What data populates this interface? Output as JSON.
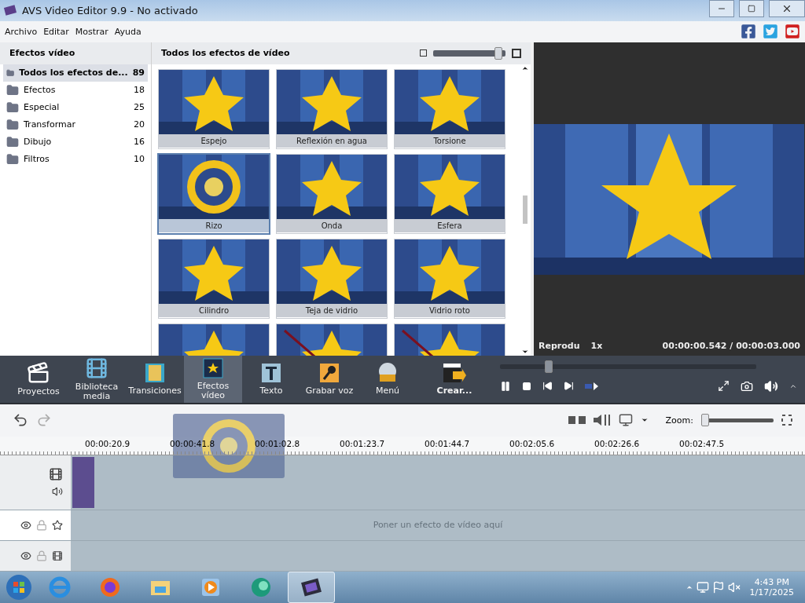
{
  "window": {
    "title": "AVS Video Editor 9.9 - No activado"
  },
  "menu": [
    "Archivo",
    "Editar",
    "Mostrar",
    "Ayuda"
  ],
  "categories": {
    "title": "Efectos vídeo",
    "items": [
      {
        "label": "Todos los efectos de...",
        "count": "89",
        "selected": true
      },
      {
        "label": "Efectos",
        "count": "18",
        "selected": false
      },
      {
        "label": "Especial",
        "count": "25",
        "selected": false
      },
      {
        "label": "Transformar",
        "count": "20",
        "selected": false
      },
      {
        "label": "Dibujo",
        "count": "16",
        "selected": false
      },
      {
        "label": "Filtros",
        "count": "10",
        "selected": false
      }
    ]
  },
  "effects": {
    "title": "Todos los efectos de vídeo",
    "size_slider": {
      "level": 0.95
    },
    "items": [
      {
        "label": "Espejo",
        "selected": false
      },
      {
        "label": "Reflexión en agua",
        "selected": false
      },
      {
        "label": "Torsione",
        "selected": false
      },
      {
        "label": "Rizo",
        "selected": true
      },
      {
        "label": "Onda",
        "selected": false
      },
      {
        "label": "Esfera",
        "selected": false
      },
      {
        "label": "Cilindro",
        "selected": false
      },
      {
        "label": "Teja de vidrio",
        "selected": false
      },
      {
        "label": "Vidrio roto",
        "selected": false
      },
      {
        "selected": false
      },
      {
        "selected": false
      },
      {
        "selected": false
      }
    ]
  },
  "preview": {
    "mode": "Reprodu",
    "speed": "1x",
    "time": "00:00:00.542 / 00:00:03.000",
    "seek": {
      "level": 0.18
    }
  },
  "toolbar": [
    {
      "label": "Proyectos",
      "kind": "projects",
      "selected": false
    },
    {
      "label": "Biblioteca media",
      "kind": "library",
      "selected": false
    },
    {
      "label": "Transiciones",
      "kind": "transitions",
      "selected": false
    },
    {
      "label": "Efectos vídeo",
      "kind": "effects",
      "selected": true
    },
    {
      "label": "Texto",
      "kind": "text",
      "selected": false
    },
    {
      "label": "Grabar voz",
      "kind": "voice",
      "selected": false
    },
    {
      "label": "Menú",
      "kind": "menu",
      "selected": false
    },
    {
      "label": "Crear...",
      "kind": "create",
      "selected": false
    }
  ],
  "timeline": {
    "zoom_label": "Zoom:",
    "zoom": {
      "level": 0
    },
    "ticks": [
      "00:00:20.9",
      "00:00:41.8",
      "00:01:02.8",
      "00:01:23.7",
      "00:01:44.7",
      "00:02:05.6",
      "00:02:26.6",
      "00:02:47.5"
    ],
    "hint": "Poner un efecto de vídeo aquí"
  },
  "taskbar": {
    "time": "4:43 PM",
    "date": "1/17/2025",
    "apps": [
      {
        "kind": "ie",
        "selected": false
      },
      {
        "kind": "firefox",
        "selected": false
      },
      {
        "kind": "explorer",
        "selected": false
      },
      {
        "kind": "media",
        "selected": false
      },
      {
        "kind": "app",
        "selected": false
      },
      {
        "kind": "avs",
        "selected": true
      }
    ]
  }
}
